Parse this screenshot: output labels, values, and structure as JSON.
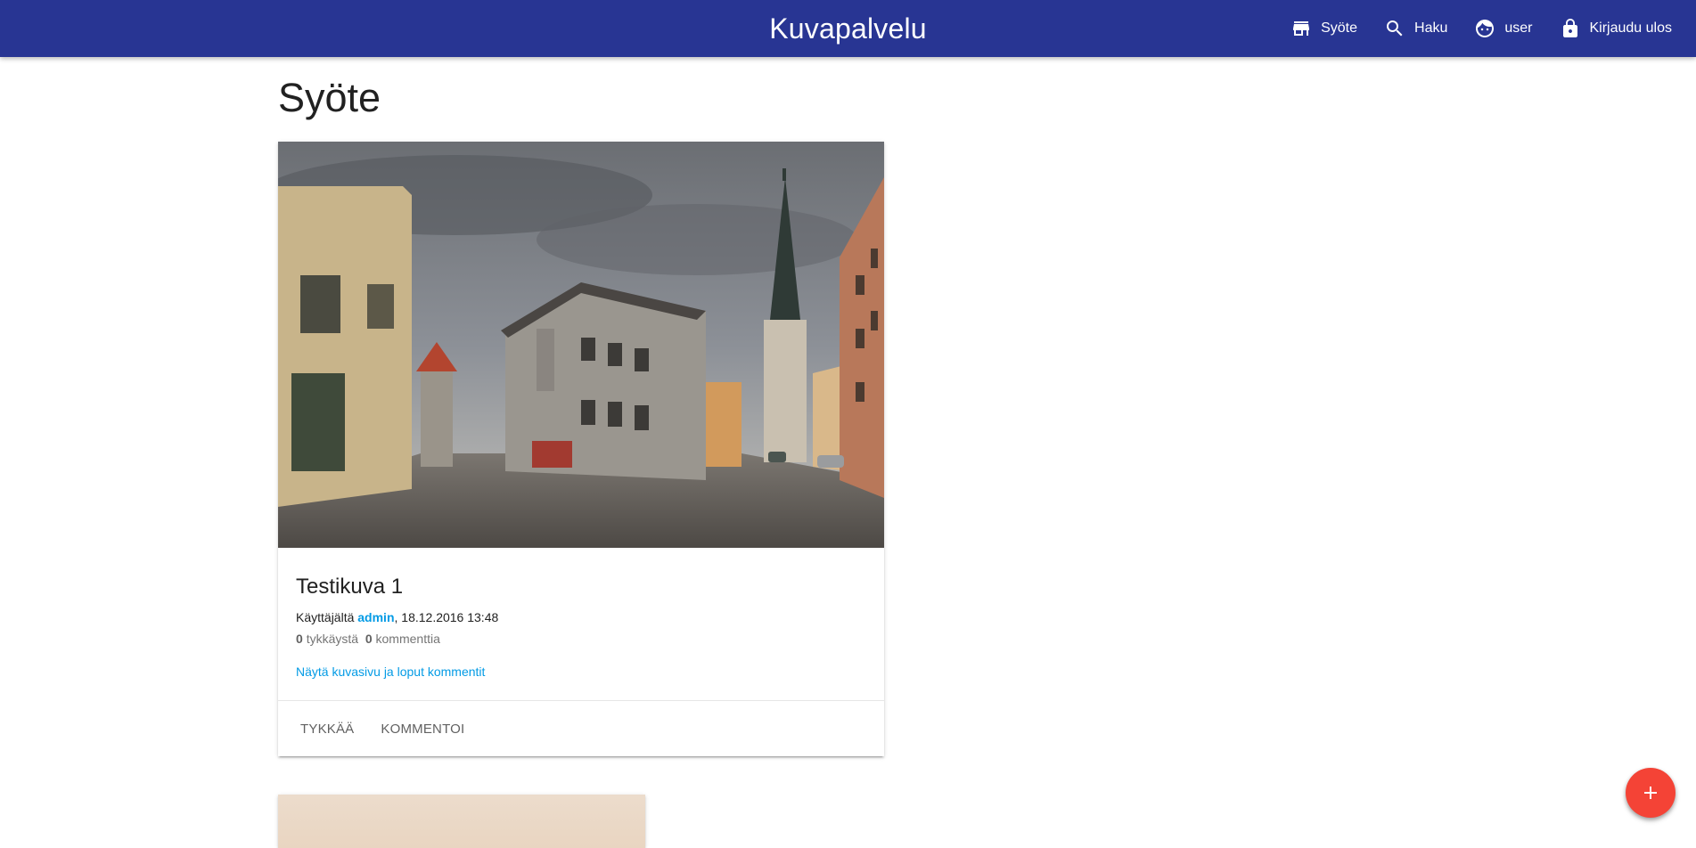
{
  "app": {
    "title": "Kuvapalvelu"
  },
  "nav": {
    "items": [
      {
        "icon": "store-icon",
        "label": "Syöte"
      },
      {
        "icon": "search-icon",
        "label": "Haku"
      },
      {
        "icon": "face-icon",
        "label": "user"
      },
      {
        "icon": "lock-icon",
        "label": "Kirjaudu ulos"
      }
    ]
  },
  "page": {
    "title": "Syöte"
  },
  "posts": [
    {
      "title": "Testikuva 1",
      "meta_prefix": "Käyttäjältä",
      "author": "admin",
      "meta_suffix": ", 18.12.2016 13:48",
      "likes": "0",
      "likes_label": "tykkäystä",
      "comments": "0",
      "comments_label": "kommenttia",
      "link": "Näytä kuvasivu ja loput kommentit",
      "actions": {
        "like": "TYKKÄÄ",
        "comment": "KOMMENTOI"
      }
    }
  ],
  "fab": {
    "icon": "add-icon"
  },
  "colors": {
    "appbar": "#283593",
    "accent": "#039be5",
    "fab": "#f44336"
  }
}
